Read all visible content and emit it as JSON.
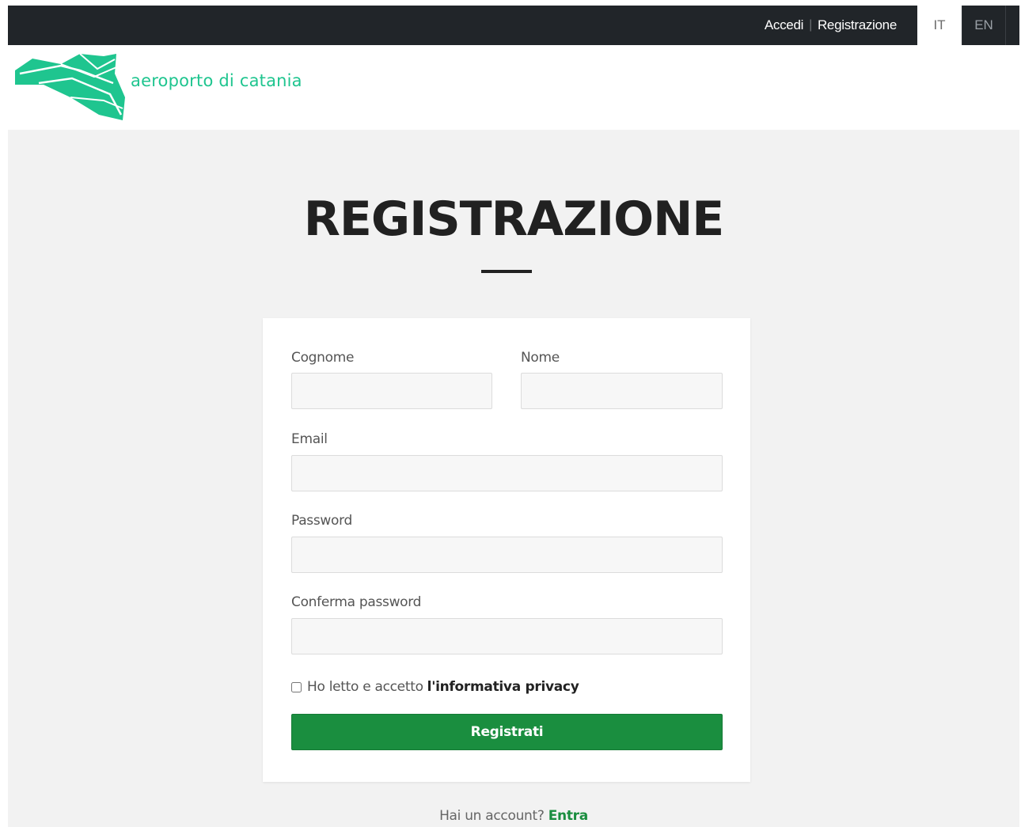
{
  "topbar": {
    "login_label": "Accedi",
    "separator": "|",
    "register_label": "Registrazione",
    "lang_it": "IT",
    "lang_en": "EN"
  },
  "header": {
    "logo_text": "aeroporto di catania",
    "logo_icon": "paper-plane-logo-icon"
  },
  "main": {
    "title": "REGISTRAZIONE",
    "form": {
      "surname_label": "Cognome",
      "surname_value": "",
      "name_label": "Nome",
      "name_value": "",
      "email_label": "Email",
      "email_value": "",
      "password_label": "Password",
      "password_value": "",
      "confirm_label": "Conferma password",
      "confirm_value": "",
      "privacy_text": "Ho letto e accetto",
      "privacy_link": "l'informativa privacy",
      "privacy_checked": false,
      "submit_label": "Registrati"
    },
    "footer": {
      "question": "Hai un account?",
      "login_link": "Entra"
    }
  },
  "colors": {
    "topbar_bg": "#212529",
    "brand_green": "#1fc58f",
    "button_green": "#1a8e3f",
    "page_bg": "#f2f2f2"
  }
}
